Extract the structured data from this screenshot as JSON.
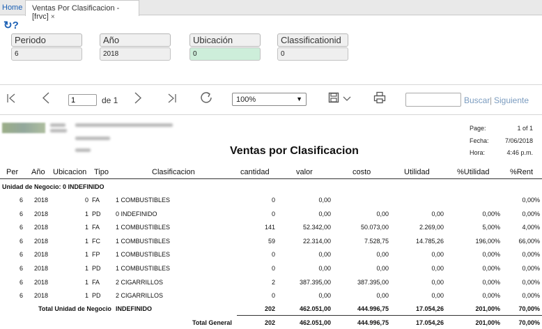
{
  "tabs": {
    "home": "Home",
    "active": "Ventas Por Clasificacion -[frvc]",
    "close": "×"
  },
  "params": [
    {
      "label": "Periodo",
      "value": "6"
    },
    {
      "label": "Año",
      "value": "2018"
    },
    {
      "label": "Ubicación",
      "value": "0"
    },
    {
      "label": "Classificationid",
      "value": "0"
    }
  ],
  "toolbar": {
    "first": "⇤",
    "prev": "<",
    "next": ">",
    "last": "⇥",
    "page": "1",
    "of": "de 1",
    "zoom": "100%",
    "search_placeholder": "",
    "search_label": "Buscar",
    "separator": "|",
    "next_label": "Siguiente"
  },
  "report": {
    "title": "Ventas por Clasificacion",
    "meta": [
      {
        "label": "Page:",
        "value": "1 of 1"
      },
      {
        "label": "Fecha:",
        "value": "7/06/2018"
      },
      {
        "label": "Hora:",
        "value": "4:46 p.m."
      }
    ],
    "columns": [
      "Per",
      "Año",
      "Ubicacion",
      "Tipo",
      "Clasificacion",
      "cantidad",
      "valor",
      "costo",
      "Utilidad",
      "%Utilidad",
      "%Rent"
    ],
    "group": "Unidad de Negocio: 0 INDEFINIDO",
    "rows": [
      {
        "per": "6",
        "anio": "2018",
        "ubicacion": "0",
        "tipo": "FA",
        "clasificacion": "1 COMBUSTIBLES",
        "cantidad": "0",
        "valor": "0,00",
        "costo": "",
        "utilidad": "",
        "putil": "",
        "rent": "0,00%"
      },
      {
        "per": "6",
        "anio": "2018",
        "ubicacion": "1",
        "tipo": "PD",
        "clasificacion": "0 INDEFINIDO",
        "cantidad": "0",
        "valor": "0,00",
        "costo": "0,00",
        "utilidad": "0,00",
        "putil": "0,00%",
        "rent": "0,00%"
      },
      {
        "per": "6",
        "anio": "2018",
        "ubicacion": "1",
        "tipo": "FA",
        "clasificacion": "1 COMBUSTIBLES",
        "cantidad": "141",
        "valor": "52.342,00",
        "costo": "50.073,00",
        "utilidad": "2.269,00",
        "putil": "5,00%",
        "rent": "4,00%"
      },
      {
        "per": "6",
        "anio": "2018",
        "ubicacion": "1",
        "tipo": "FC",
        "clasificacion": "1 COMBUSTIBLES",
        "cantidad": "59",
        "valor": "22.314,00",
        "costo": "7.528,75",
        "utilidad": "14.785,26",
        "putil": "196,00%",
        "rent": "66,00%"
      },
      {
        "per": "6",
        "anio": "2018",
        "ubicacion": "1",
        "tipo": "FP",
        "clasificacion": "1 COMBUSTIBLES",
        "cantidad": "0",
        "valor": "0,00",
        "costo": "0,00",
        "utilidad": "0,00",
        "putil": "0,00%",
        "rent": "0,00%"
      },
      {
        "per": "6",
        "anio": "2018",
        "ubicacion": "1",
        "tipo": "PD",
        "clasificacion": "1 COMBUSTIBLES",
        "cantidad": "0",
        "valor": "0,00",
        "costo": "0,00",
        "utilidad": "0,00",
        "putil": "0,00%",
        "rent": "0,00%"
      },
      {
        "per": "6",
        "anio": "2018",
        "ubicacion": "1",
        "tipo": "FA",
        "clasificacion": "2 CIGARRILLOS",
        "cantidad": "2",
        "valor": "387.395,00",
        "costo": "387.395,00",
        "utilidad": "0,00",
        "putil": "0,00%",
        "rent": "0,00%"
      },
      {
        "per": "6",
        "anio": "2018",
        "ubicacion": "1",
        "tipo": "PD",
        "clasificacion": "2 CIGARRILLOS",
        "cantidad": "0",
        "valor": "0,00",
        "costo": "0,00",
        "utilidad": "0,00",
        "putil": "0,00%",
        "rent": "0,00%"
      }
    ],
    "subtotal": {
      "label": "Total Unidad de Negocio",
      "name": "INDEFINIDO",
      "cantidad": "202",
      "valor": "462.051,00",
      "costo": "444.996,75",
      "utilidad": "17.054,26",
      "putil": "201,00%",
      "rent": "70,00%"
    },
    "total": {
      "label": "Total General",
      "cantidad": "202",
      "valor": "462.051,00",
      "costo": "444.996,75",
      "utilidad": "17.054,26",
      "putil": "201,00%",
      "rent": "70,00%"
    }
  }
}
